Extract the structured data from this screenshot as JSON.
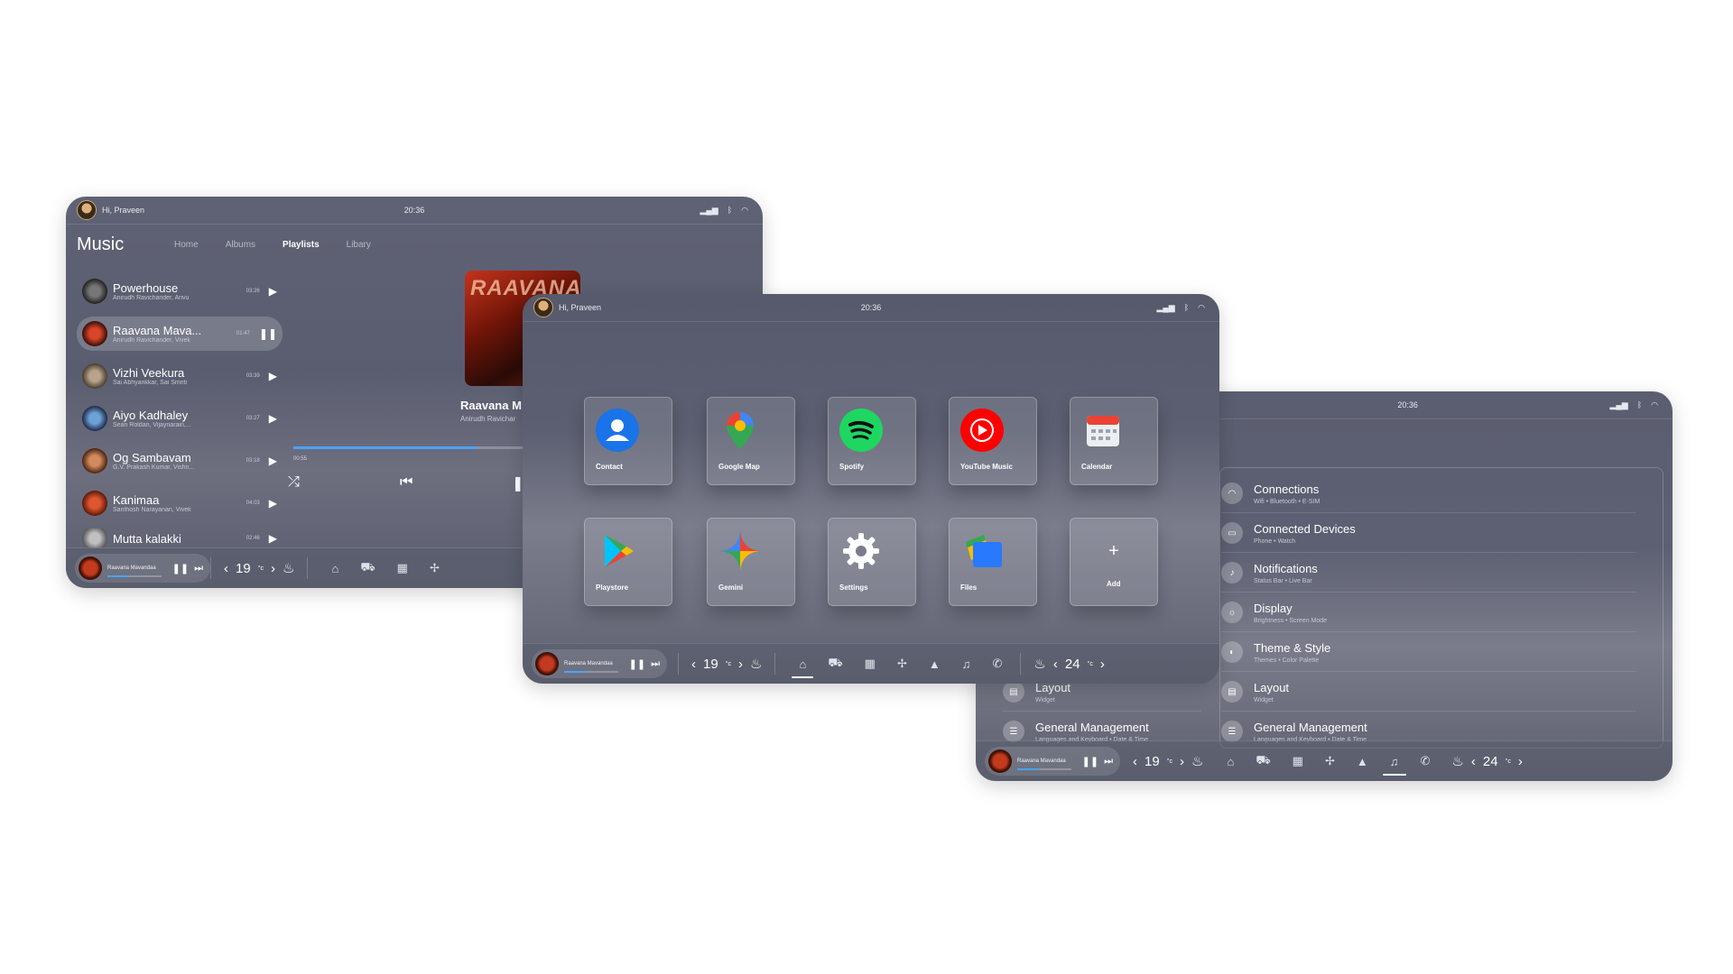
{
  "common": {
    "greeting": "Hi, Praveen",
    "time": "20:36",
    "mini_player": {
      "title": "Raavana Mavandaa",
      "progress": 0.4
    },
    "temp_left": "19",
    "temp_right": "24",
    "temp_unit": "°c"
  },
  "music": {
    "title": "Music",
    "tabs": [
      "Home",
      "Albums",
      "Playlists",
      "Libary"
    ],
    "active_tab": "Playlists",
    "songs": [
      {
        "name": "Powerhouse",
        "artist": "Anirudh Ravichander, Arivu",
        "duration": "03:26",
        "state": "play"
      },
      {
        "name": "Raavana Mava...",
        "artist": "Anirudh Ravichander, Vivek",
        "duration": "01:47",
        "state": "pause"
      },
      {
        "name": "Vizhi Veekura",
        "artist": "Sai Abhyankkar, Sai Smriti",
        "duration": "03:39",
        "state": "play"
      },
      {
        "name": "Aiyo Kadhaley",
        "artist": "Sean Roldan, Vijaynarain,...",
        "duration": "03:27",
        "state": "play"
      },
      {
        "name": "Og Sambavam",
        "artist": "G.V. Prakash Kumar, Vishn...",
        "duration": "03:18",
        "state": "play"
      },
      {
        "name": "Kanimaa",
        "artist": "Santhosh Narayanan, Vivek",
        "duration": "04:03",
        "state": "play"
      },
      {
        "name": "Mutta kalakki",
        "artist": "",
        "duration": "02:46",
        "state": "play"
      }
    ],
    "now_playing": {
      "title": "Raavana M",
      "artist": "Anirudh Ravichar",
      "elapsed": "00:55",
      "progress": 0.78,
      "cover_text": "RAAVANA"
    }
  },
  "apps": {
    "items": [
      {
        "label": "Contact",
        "color": "#1a73e8",
        "icon": "contact-icon"
      },
      {
        "label": "Google Map",
        "color": "#34a853",
        "icon": "map-pin-icon"
      },
      {
        "label": "Spotify",
        "color": "#1ed760",
        "icon": "spotify-icon"
      },
      {
        "label": "YouTube Music",
        "color": "#ff0000",
        "icon": "youtube-music-icon"
      },
      {
        "label": "Calendar",
        "color": "#e0e0e0",
        "icon": "calendar-icon"
      },
      {
        "label": "Playstore",
        "color": "#00c3ff",
        "icon": "playstore-icon"
      },
      {
        "label": "Gemini",
        "color": "#4285f4",
        "icon": "gemini-icon"
      },
      {
        "label": "Settings",
        "color": "#ffffff",
        "icon": "gear-icon"
      },
      {
        "label": "Files",
        "color": "#2979ff",
        "icon": "files-icon"
      },
      {
        "label": "Add",
        "color": "#ffffff",
        "icon": "plus-icon"
      }
    ]
  },
  "settings": {
    "items": [
      {
        "title": "Connections",
        "sub": "Wifi • Bluetooth • E-SIM"
      },
      {
        "title": "Connected Devices",
        "sub": "Phone • Watch"
      },
      {
        "title": "Notifications",
        "sub": "Status Bar • Live Bar"
      },
      {
        "title": "Display",
        "sub": "Brightness • Screen Mode"
      },
      {
        "title": "Theme & Style",
        "sub": "Themes • Color Palette"
      },
      {
        "title": "Layout",
        "sub": "Widget"
      },
      {
        "title": "General Management",
        "sub": "Languages and Keyboard • Date & Time"
      }
    ],
    "left_items": [
      {
        "title": "Layout",
        "sub": "Widget"
      },
      {
        "title": "General Management",
        "sub": "Languages and Keyboard • Date & Time"
      }
    ]
  }
}
